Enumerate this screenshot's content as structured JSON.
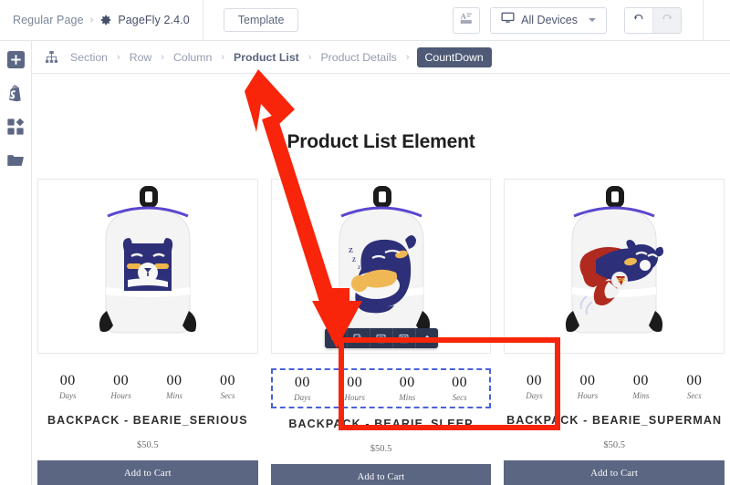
{
  "topbar": {
    "page_name": "Regular Page",
    "separator": "›",
    "brand": "PageFly 2.4.0",
    "gear_icon": "gear-icon",
    "template_label": "Template",
    "typography_icon": "typography-icon",
    "device_icon": "desktop-icon",
    "devices_label": "All Devices",
    "undo_icon": "undo-icon",
    "redo_icon": "redo-icon"
  },
  "rail": {
    "items": [
      {
        "icon": "add-element-icon",
        "name": "add-element"
      },
      {
        "icon": "shopify-icon",
        "name": "shopify"
      },
      {
        "icon": "library-grid-icon",
        "name": "library"
      },
      {
        "icon": "folder-icon",
        "name": "assets"
      }
    ]
  },
  "breadcrumb": {
    "tree_icon": "sitemap-icon",
    "arrow": "›",
    "items": [
      {
        "label": "Section",
        "state": "normal"
      },
      {
        "label": "Row",
        "state": "normal"
      },
      {
        "label": "Column",
        "state": "normal"
      },
      {
        "label": "Product List",
        "state": "highlight"
      },
      {
        "label": "Product Details",
        "state": "normal"
      },
      {
        "label": "CountDown",
        "state": "active"
      }
    ]
  },
  "canvas": {
    "heading": "Product List Element",
    "countdown_units": [
      "Days",
      "Hours",
      "Mins",
      "Secs"
    ],
    "countdown_value": "00",
    "add_to_cart_label": "Add to Cart",
    "products": [
      {
        "title": "BACKPACK - BEARIE_SERIOUS",
        "price": "$50.5",
        "image": "backpack-bearie-serious",
        "selected": false
      },
      {
        "title": "BACKPACK - BEARIE_SLEEP",
        "price": "$50.5",
        "image": "backpack-bearie-sleep",
        "selected": true
      },
      {
        "title": "BACKPACK - BEARIE_SUPERMAN",
        "price": "$50.5",
        "image": "backpack-bearie-superman",
        "selected": false
      }
    ]
  },
  "element_toolbar": {
    "buttons": [
      {
        "icon": "move-handle-icon",
        "name": "move"
      },
      {
        "icon": "duplicate-icon",
        "name": "duplicate"
      },
      {
        "icon": "layout-icon",
        "name": "layout"
      },
      {
        "icon": "settings-panel-icon",
        "name": "settings"
      },
      {
        "icon": "delete-icon",
        "name": "delete"
      }
    ]
  },
  "annotations": {
    "arrow_color": "#f8250b",
    "box_color": "#f8250b",
    "arrow_name": "red-callout-arrow",
    "box_name": "red-callout-box"
  },
  "colors": {
    "accent": "#4e5a76",
    "selection": "#4a62d8",
    "button": "#5a6682",
    "annotation": "#f8250b"
  }
}
